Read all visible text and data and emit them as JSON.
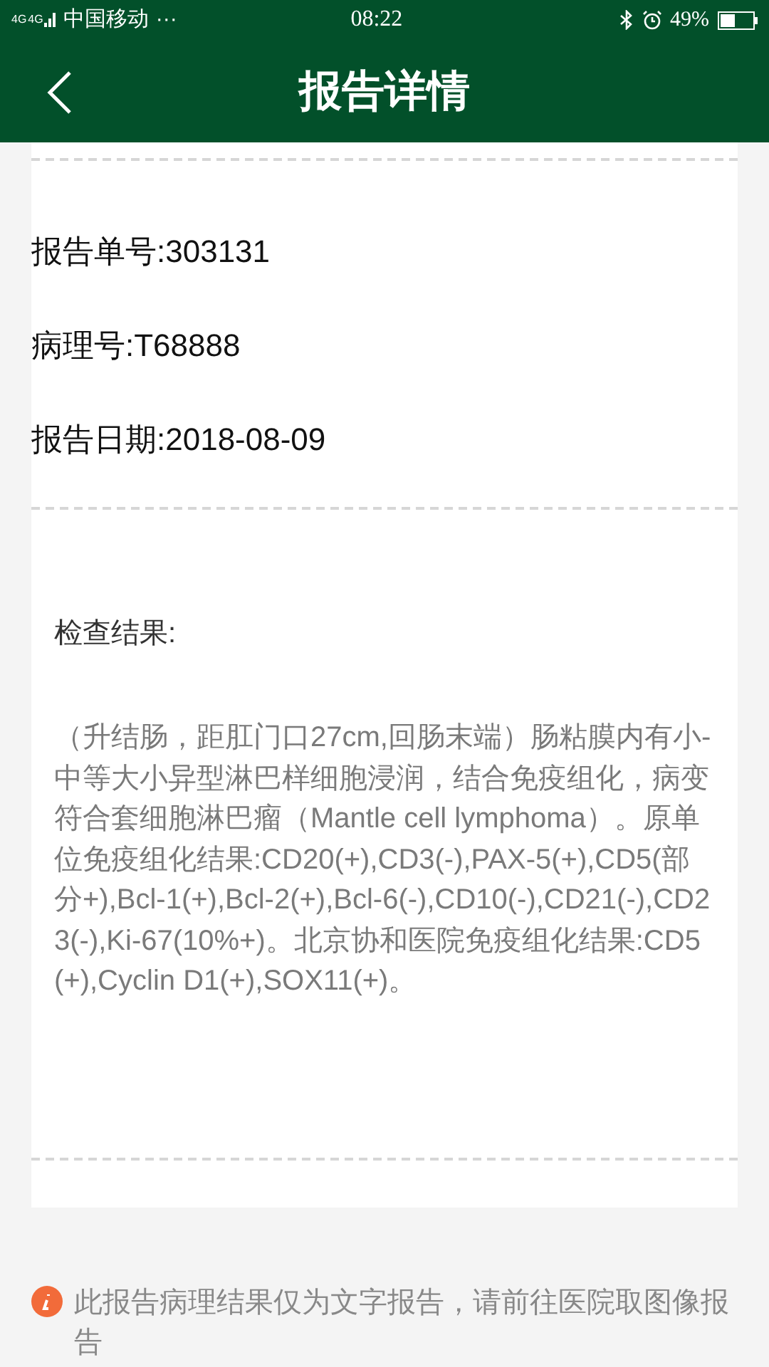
{
  "status_bar": {
    "network": [
      "4G",
      "4G"
    ],
    "carrier": "中国移动",
    "more": "···",
    "time": "08:22",
    "battery": "49%"
  },
  "nav": {
    "title": "报告详情"
  },
  "info": [
    {
      "label": "报告单号:",
      "value": "303131"
    },
    {
      "label": "病理号:",
      "value": "T68888"
    },
    {
      "label": "报告日期:",
      "value": "2018-08-09"
    }
  ],
  "result": {
    "heading": "检查结果:",
    "text": "（升结肠，距肛门口27cm,回肠末端）肠粘膜内有小-中等大小异型淋巴样细胞浸润，结合免疫组化，病变符合套细胞淋巴瘤（Mantle cell lymphoma）。原单位免疫组化结果:CD20(+),CD3(-),PAX-5(+),CD5(部分+),Bcl-1(+),Bcl-2(+),Bcl-6(-),CD10(-),CD21(-),CD23(-),Ki-67(10%+)。北京协和医院免疫组化结果:CD5(+),Cyclin D1(+),SOX11(+)。"
  },
  "notice": "此报告病理结果仅为文字报告，请前往医院取图像报告"
}
